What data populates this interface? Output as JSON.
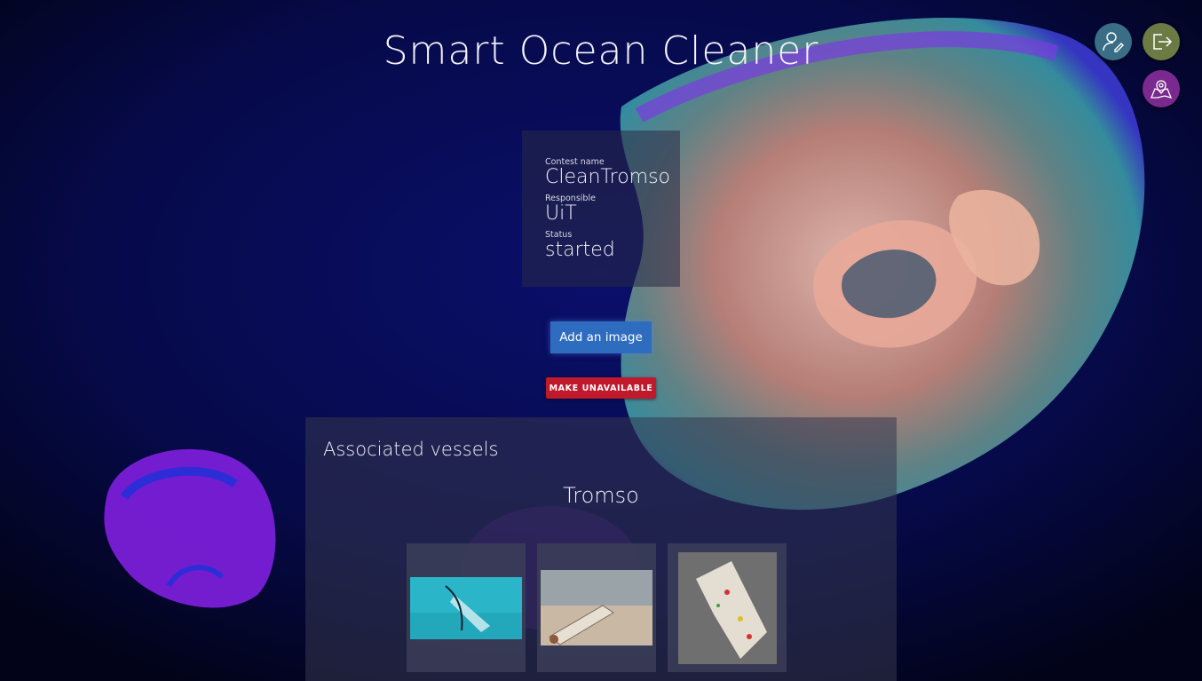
{
  "app": {
    "title": "Smart Ocean Cleaner"
  },
  "header_icons": [
    {
      "name": "edit-profile-icon",
      "color": "#3a6e86"
    },
    {
      "name": "logout-icon",
      "color": "#6c7a44"
    },
    {
      "name": "map-icon",
      "color": "#7a2a8e"
    }
  ],
  "contest": {
    "name_label": "Contest name",
    "name_value": "CleanTromso",
    "responsible_label": "Responsible",
    "responsible_value": "UiT",
    "status_label": "Status",
    "status_value": "started"
  },
  "actions": {
    "add_image_label": "Add an image",
    "make_unavailable_label": "MAKE UNAVAILABLE"
  },
  "vessels": {
    "section_title": "Associated vessels",
    "items": [
      {
        "name": "Tromso",
        "images": [
          "plastic-bottle-underwater",
          "plastic-bottle-beach",
          "plastic-wrapper-sand"
        ]
      }
    ]
  },
  "colors": {
    "background": "#05073a",
    "add_button": "#2e6cc0",
    "unavailable_button": "#c0192b"
  }
}
